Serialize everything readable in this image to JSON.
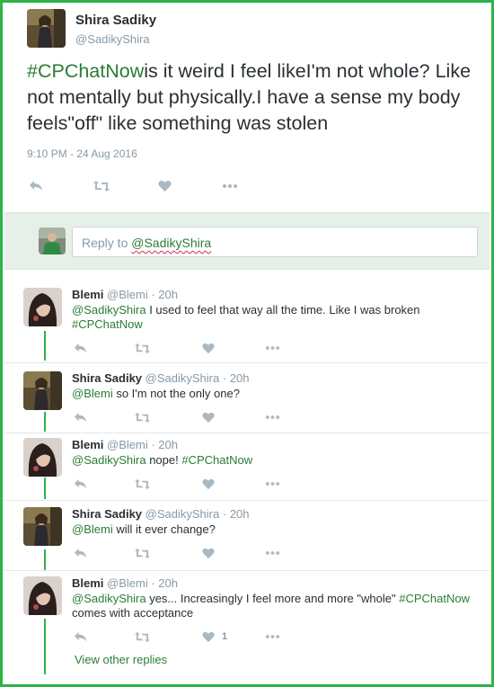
{
  "main_tweet": {
    "name": "Shira Sadiky",
    "handle": "@SadikyShira",
    "hashtag": "#CPChatNow",
    "text": "is it weird I feel likeI'm not whole? Like not mentally but physically.I have a sense my body feels\"off\" like something was stolen",
    "timestamp": "9:10 PM - 24 Aug 2016"
  },
  "composer": {
    "placeholder_prefix": "Reply to ",
    "mention": "@SadikyShira"
  },
  "replies": [
    {
      "name": "Blemi",
      "handle": "@Blemi",
      "age": "· 20h",
      "mention": "@SadikyShira",
      "text": " I used to feel that way all the time. Like I was broken",
      "hashtag": "#CPChatNow",
      "likes": ""
    },
    {
      "name": "Shira Sadiky",
      "handle": "@SadikyShira",
      "age": "· 20h",
      "mention": "@Blemi",
      "text": " so I'm not the only one?",
      "hashtag": "",
      "likes": ""
    },
    {
      "name": "Blemi",
      "handle": "@Blemi",
      "age": "· 20h",
      "mention": "@SadikyShira",
      "text": " nope! ",
      "hashtag": "#CPChatNow",
      "likes": ""
    },
    {
      "name": "Shira Sadiky",
      "handle": "@SadikyShira",
      "age": "· 20h",
      "mention": "@Blemi",
      "text": " will it ever change?",
      "hashtag": "",
      "likes": ""
    },
    {
      "name": "Blemi",
      "handle": "@Blemi",
      "age": "· 20h",
      "mention": "@SadikyShira",
      "text": " yes... Increasingly I feel more and more \"whole\" ",
      "hashtag": "#CPChatNow",
      "text_after": "comes with acceptance",
      "likes": "1"
    }
  ],
  "view_more": "View other replies",
  "colors": {
    "frame": "#2eb34a",
    "link": "#2a7d36",
    "muted": "#8899a6",
    "text": "#292f33",
    "composer_bg": "#e6f0e8"
  },
  "icons": [
    "reply-icon",
    "retweet-icon",
    "like-icon",
    "more-icon"
  ]
}
